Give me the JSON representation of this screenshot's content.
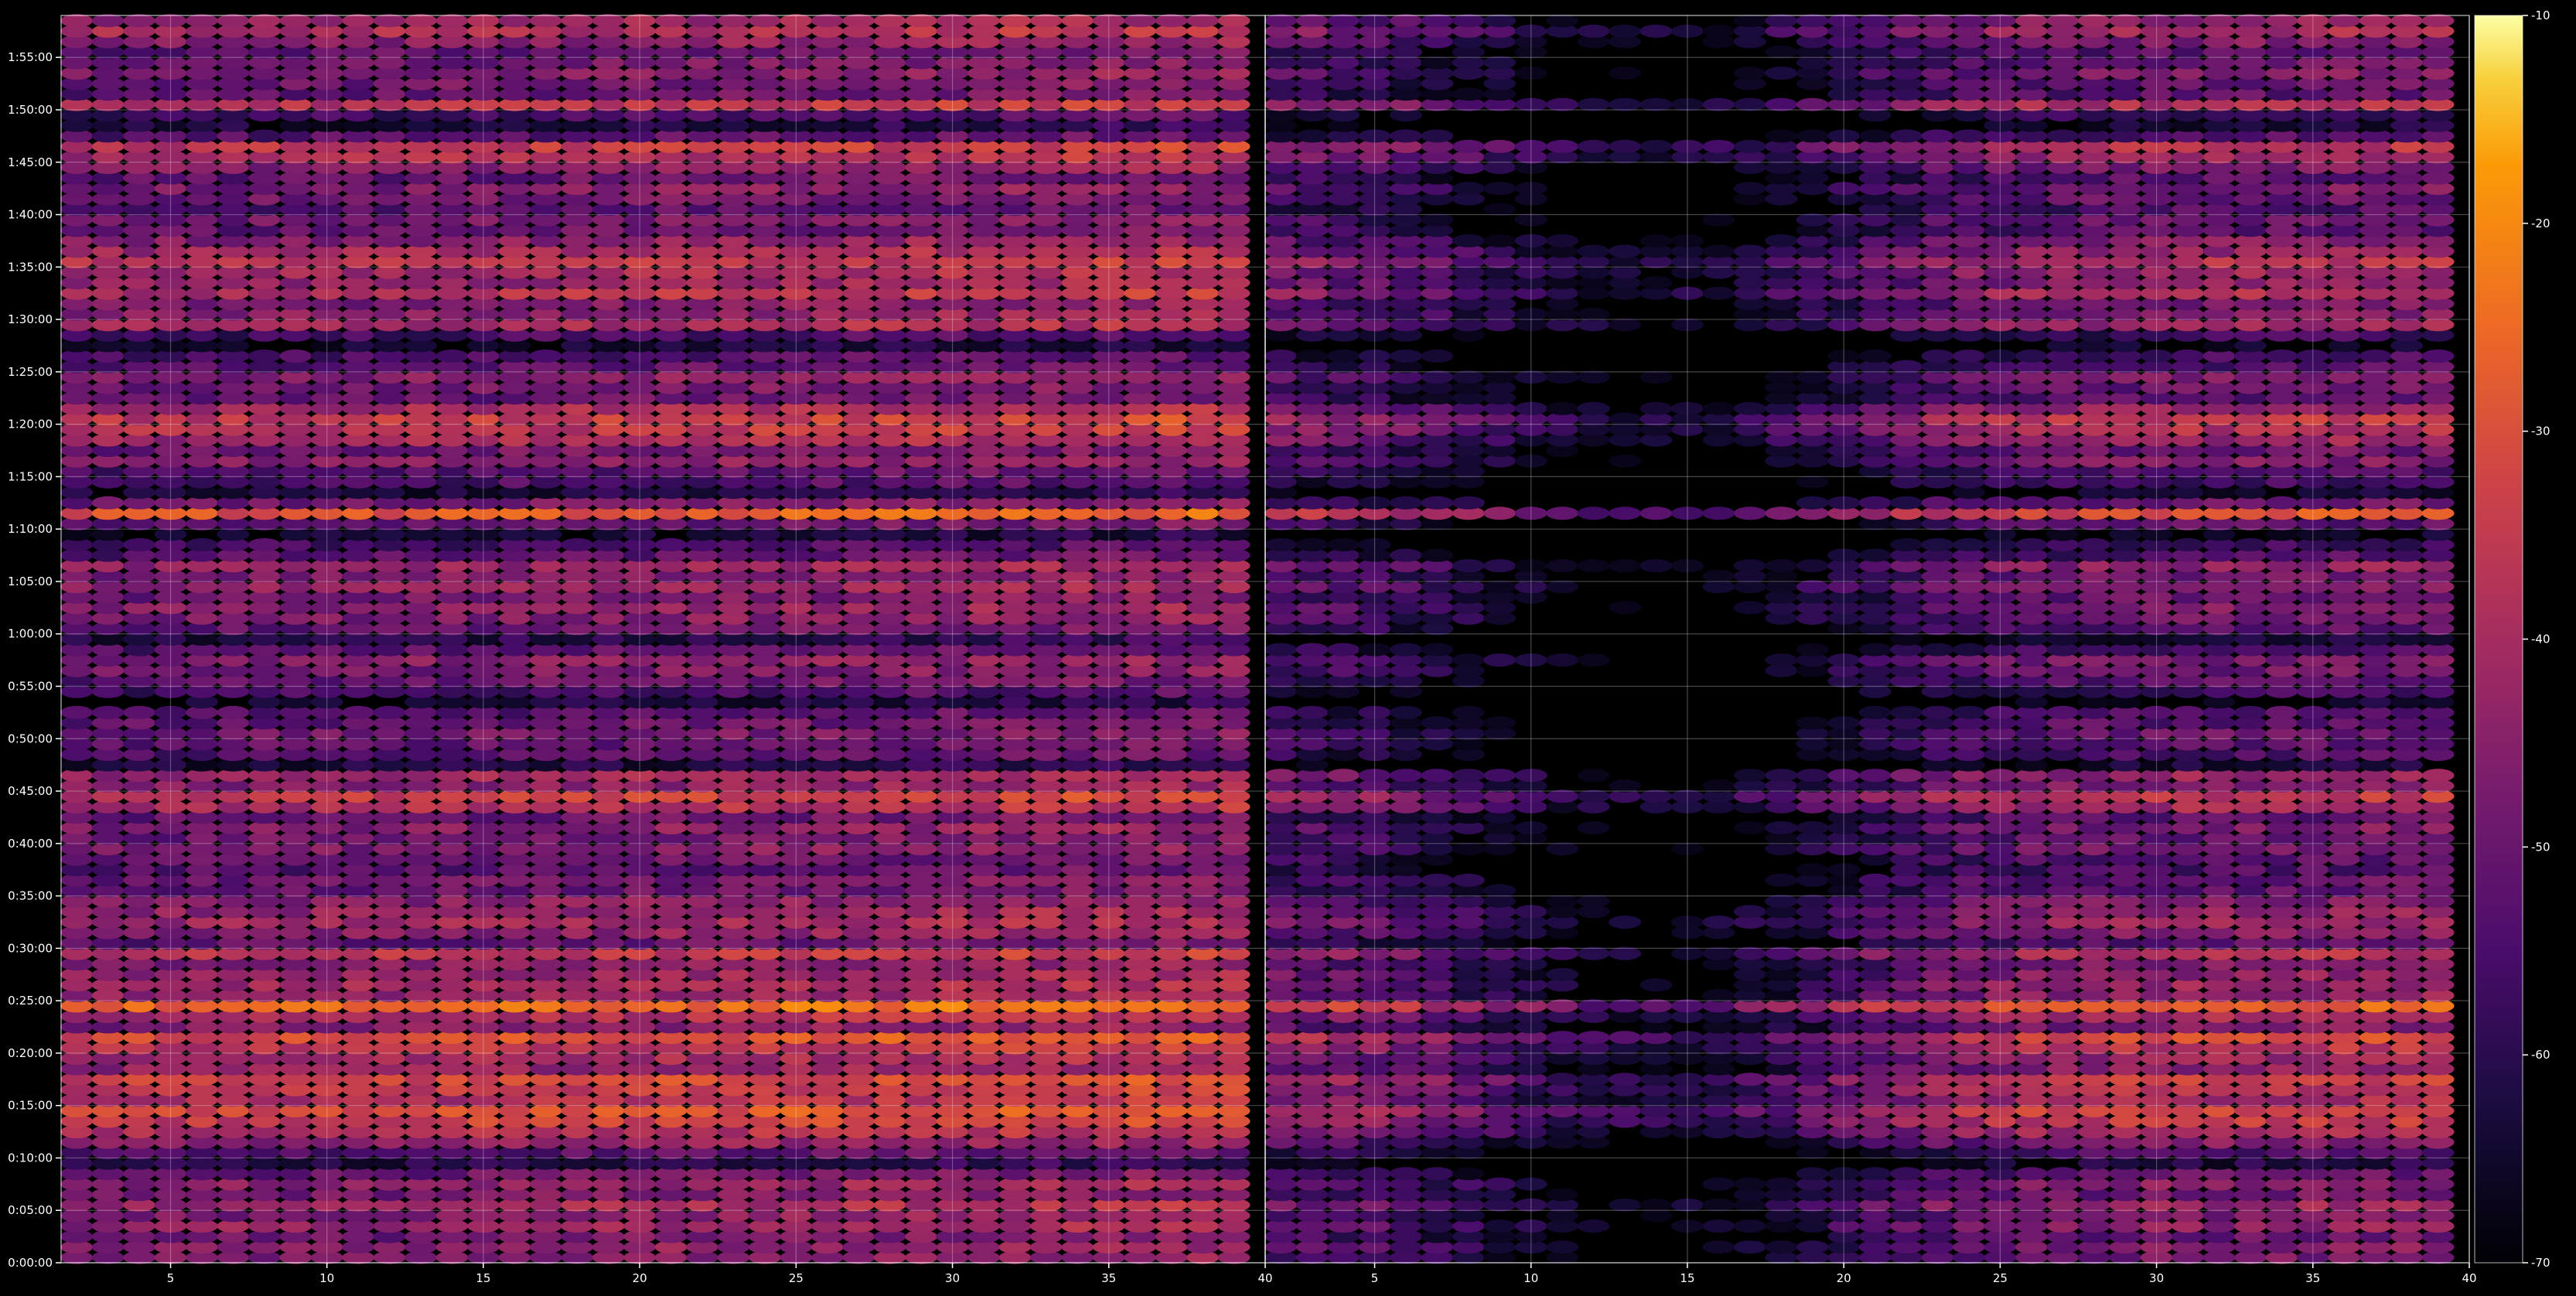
{
  "chart_data": {
    "type": "heatmap",
    "title": "",
    "xlabel": "",
    "ylabel": "",
    "colormap": "inferno",
    "background": "#000000",
    "grid": true,
    "color_scale": {
      "min": -70,
      "max": -10,
      "ticks": [
        -10,
        -20,
        -30,
        -40,
        -50,
        -60,
        -70
      ]
    },
    "y_ticks": [
      "0:00:00",
      "0:05:00",
      "0:10:00",
      "0:15:00",
      "0:20:00",
      "0:25:00",
      "0:30:00",
      "0:35:00",
      "0:40:00",
      "0:45:00",
      "0:50:00",
      "0:55:00",
      "1:00:00",
      "1:05:00",
      "1:10:00",
      "1:15:00",
      "1:20:00",
      "1:25:00",
      "1:30:00",
      "1:35:00",
      "1:40:00",
      "1:45:00",
      "1:50:00",
      "1:55:00"
    ],
    "y_range_minutes": [
      0,
      119
    ],
    "panels": [
      {
        "name": "left",
        "x_range": [
          1.5,
          40
        ],
        "x_ticks": [
          "5",
          "10",
          "15",
          "20",
          "25",
          "30",
          "35",
          "40"
        ],
        "x_tick_values": [
          5,
          10,
          15,
          20,
          25,
          30,
          35,
          40
        ],
        "bins": [
          2,
          40
        ],
        "channels_min_max": [
          2,
          39
        ],
        "level_scale": 1.0
      },
      {
        "name": "right",
        "x_range": [
          1.5,
          40
        ],
        "x_ticks": [
          "5",
          "10",
          "15",
          "20",
          "25",
          "30",
          "35",
          "40"
        ],
        "x_tick_values": [
          5,
          10,
          15,
          20,
          25,
          30,
          35,
          40
        ],
        "channels_min_max": [
          2,
          39
        ],
        "level_scale": 0.55
      }
    ],
    "time_profile_db": [
      {
        "t": 0.5,
        "db": -46
      },
      {
        "t": 1.5,
        "db": -44
      },
      {
        "t": 2.5,
        "db": -48
      },
      {
        "t": 3.5,
        "db": -42
      },
      {
        "t": 4.5,
        "db": -45
      },
      {
        "t": 5.5,
        "db": -40
      },
      {
        "t": 6.5,
        "db": -47
      },
      {
        "t": 7.5,
        "db": -43
      },
      {
        "t": 8.5,
        "db": -49
      },
      {
        "t": 9.5,
        "db": -60
      },
      {
        "t": 10.5,
        "db": -52
      },
      {
        "t": 11.5,
        "db": -44
      },
      {
        "t": 12.5,
        "db": -38
      },
      {
        "t": 13.5,
        "db": -33
      },
      {
        "t": 14.5,
        "db": -30
      },
      {
        "t": 15.5,
        "db": -38
      },
      {
        "t": 16.5,
        "db": -35
      },
      {
        "t": 17.5,
        "db": -32
      },
      {
        "t": 18.5,
        "db": -42
      },
      {
        "t": 19.5,
        "db": -40
      },
      {
        "t": 20.5,
        "db": -35
      },
      {
        "t": 21.5,
        "db": -30
      },
      {
        "t": 22.5,
        "db": -45
      },
      {
        "t": 23.5,
        "db": -38
      },
      {
        "t": 24.5,
        "db": -25
      },
      {
        "t": 25.5,
        "db": -42
      },
      {
        "t": 26.5,
        "db": -40
      },
      {
        "t": 27.5,
        "db": -42
      },
      {
        "t": 28.5,
        "db": -45
      },
      {
        "t": 29.5,
        "db": -36
      },
      {
        "t": 30.5,
        "db": -50
      },
      {
        "t": 31.5,
        "db": -44
      },
      {
        "t": 32.5,
        "db": -40
      },
      {
        "t": 33.5,
        "db": -42
      },
      {
        "t": 34.5,
        "db": -45
      },
      {
        "t": 35.5,
        "db": -50
      },
      {
        "t": 36.5,
        "db": -48
      },
      {
        "t": 37.5,
        "db": -52
      },
      {
        "t": 38.5,
        "db": -50
      },
      {
        "t": 39.5,
        "db": -46
      },
      {
        "t": 40.5,
        "db": -48
      },
      {
        "t": 41.5,
        "db": -45
      },
      {
        "t": 42.5,
        "db": -50
      },
      {
        "t": 43.5,
        "db": -38
      },
      {
        "t": 44.5,
        "db": -34
      },
      {
        "t": 45.5,
        "db": -44
      },
      {
        "t": 46.5,
        "db": -40
      },
      {
        "t": 47.5,
        "db": -62
      },
      {
        "t": 48.5,
        "db": -52
      },
      {
        "t": 49.5,
        "db": -50
      },
      {
        "t": 50.5,
        "db": -48
      },
      {
        "t": 51.5,
        "db": -50
      },
      {
        "t": 52.5,
        "db": -52
      },
      {
        "t": 53.5,
        "db": -63
      },
      {
        "t": 54.5,
        "db": -55
      },
      {
        "t": 55.5,
        "db": -50
      },
      {
        "t": 56.5,
        "db": -47
      },
      {
        "t": 57.5,
        "db": -45
      },
      {
        "t": 58.5,
        "db": -52
      },
      {
        "t": 59.5,
        "db": -60
      },
      {
        "t": 60.5,
        "db": -50
      },
      {
        "t": 61.5,
        "db": -46
      },
      {
        "t": 62.5,
        "db": -44
      },
      {
        "t": 63.5,
        "db": -48
      },
      {
        "t": 64.5,
        "db": -43
      },
      {
        "t": 65.5,
        "db": -46
      },
      {
        "t": 66.5,
        "db": -42
      },
      {
        "t": 67.5,
        "db": -52
      },
      {
        "t": 68.5,
        "db": -55
      },
      {
        "t": 69.5,
        "db": -64
      },
      {
        "t": 70.5,
        "db": -50
      },
      {
        "t": 71.5,
        "db": -28
      },
      {
        "t": 72.5,
        "db": -48
      },
      {
        "t": 73.5,
        "db": -62
      },
      {
        "t": 74.5,
        "db": -54
      },
      {
        "t": 75.5,
        "db": -52
      },
      {
        "t": 76.5,
        "db": -45
      },
      {
        "t": 77.5,
        "db": -48
      },
      {
        "t": 78.5,
        "db": -40
      },
      {
        "t": 79.5,
        "db": -36
      },
      {
        "t": 80.5,
        "db": -34
      },
      {
        "t": 81.5,
        "db": -40
      },
      {
        "t": 82.5,
        "db": -50
      },
      {
        "t": 83.5,
        "db": -48
      },
      {
        "t": 84.5,
        "db": -45
      },
      {
        "t": 85.5,
        "db": -52
      },
      {
        "t": 86.5,
        "db": -54
      },
      {
        "t": 87.5,
        "db": -64
      },
      {
        "t": 88.5,
        "db": -55
      },
      {
        "t": 89.5,
        "db": -40
      },
      {
        "t": 90.5,
        "db": -44
      },
      {
        "t": 91.5,
        "db": -46
      },
      {
        "t": 92.5,
        "db": -37
      },
      {
        "t": 93.5,
        "db": -42
      },
      {
        "t": 94.5,
        "db": -40
      },
      {
        "t": 95.5,
        "db": -36
      },
      {
        "t": 96.5,
        "db": -40
      },
      {
        "t": 97.5,
        "db": -44
      },
      {
        "t": 98.5,
        "db": -50
      },
      {
        "t": 99.5,
        "db": -47
      },
      {
        "t": 100.5,
        "db": -52
      },
      {
        "t": 101.5,
        "db": -48
      },
      {
        "t": 102.5,
        "db": -46
      },
      {
        "t": 103.5,
        "db": -50
      },
      {
        "t": 104.5,
        "db": -44
      },
      {
        "t": 105.5,
        "db": -38
      },
      {
        "t": 106.5,
        "db": -35
      },
      {
        "t": 107.5,
        "db": -52
      },
      {
        "t": 108.5,
        "db": -62
      },
      {
        "t": 109.5,
        "db": -55
      },
      {
        "t": 110.5,
        "db": -36
      },
      {
        "t": 111.5,
        "db": -50
      },
      {
        "t": 112.5,
        "db": -48
      },
      {
        "t": 113.5,
        "db": -45
      },
      {
        "t": 114.5,
        "db": -48
      },
      {
        "t": 115.5,
        "db": -50
      },
      {
        "t": 116.5,
        "db": -44
      },
      {
        "t": 117.5,
        "db": -38
      },
      {
        "t": 118.5,
        "db": -42
      }
    ]
  }
}
